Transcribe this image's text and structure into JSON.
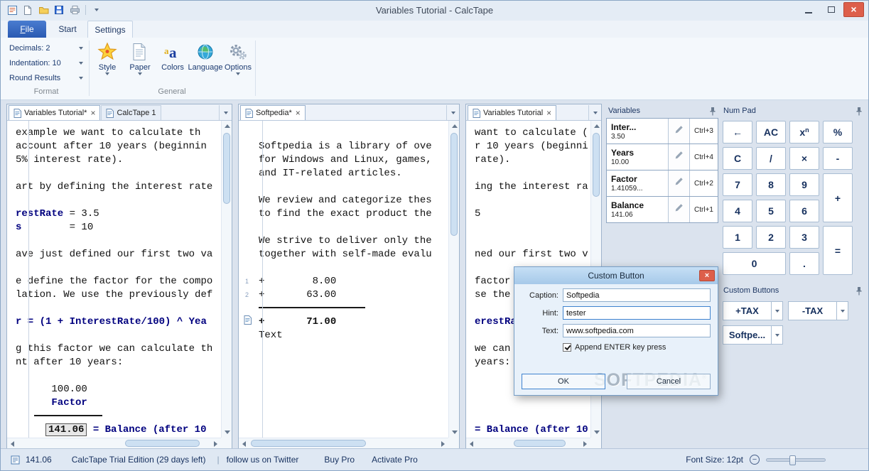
{
  "window": {
    "title": "Variables Tutorial - CalcTape"
  },
  "ribbon": {
    "tabs": [
      {
        "label": "File"
      },
      {
        "label": "Start"
      },
      {
        "label": "Settings"
      }
    ],
    "format_group": {
      "label": "Format",
      "rows": [
        "Decimals: 2",
        "Indentation: 10",
        "Round Results"
      ]
    },
    "general_group": {
      "label": "General",
      "buttons": [
        {
          "label": "Style"
        },
        {
          "label": "Paper"
        },
        {
          "label": "Colors"
        },
        {
          "label": "Language"
        },
        {
          "label": "Options"
        }
      ]
    }
  },
  "panes": [
    {
      "tabs": [
        {
          "label": "Variables Tutorial*",
          "active": true,
          "closable": true
        },
        {
          "label": "CalcTape 1",
          "active": false,
          "closable": false
        }
      ],
      "gutter": false,
      "lines": [
        {
          "s": [
            [
              "example we want to calculate th",
              ""
            ]
          ]
        },
        {
          "s": [
            [
              "account after 10 years (beginnin",
              ""
            ]
          ]
        },
        {
          "s": [
            [
              "5% interest rate).",
              ""
            ]
          ]
        },
        {},
        {
          "s": [
            [
              "art by defining the interest rate",
              ""
            ]
          ]
        },
        {},
        {
          "s": [
            [
              "restRate",
              "nv"
            ],
            [
              " = 3.5",
              ""
            ]
          ]
        },
        {
          "s": [
            [
              "s",
              "nv"
            ],
            [
              "        = 10",
              ""
            ]
          ]
        },
        {},
        {
          "s": [
            [
              "ave just defined our first two va",
              ""
            ]
          ]
        },
        {},
        {
          "s": [
            [
              "e define the factor for the compo",
              ""
            ]
          ]
        },
        {
          "s": [
            [
              "lation. We use the previously def",
              ""
            ]
          ]
        },
        {},
        {
          "s": [
            [
              "r = (1 + InterestRate/100) ^ Yea",
              "nv"
            ]
          ]
        },
        {},
        {
          "s": [
            [
              "g this factor we can calculate th",
              ""
            ]
          ]
        },
        {
          "s": [
            [
              "nt after 10 years:",
              ""
            ]
          ]
        },
        {},
        {
          "s": [
            [
              "      100.00",
              ""
            ]
          ]
        },
        {
          "s": [
            [
              "      Factor",
              "nv"
            ]
          ]
        },
        {
          "hr": true
        },
        {
          "s": [
            [
              "     ",
              ""
            ],
            [
              "141.06",
              "box"
            ],
            [
              " ",
              ""
            ],
            [
              "= Balance (after 10 ",
              "nv"
            ]
          ]
        }
      ]
    },
    {
      "tabs": [
        {
          "label": "Softpedia*",
          "active": true,
          "closable": true
        }
      ],
      "gutter": true,
      "lines": [
        {},
        {
          "s": [
            [
              "Softpedia is a library of ove",
              ""
            ]
          ]
        },
        {
          "s": [
            [
              "for Windows and Linux, games,",
              ""
            ]
          ]
        },
        {
          "s": [
            [
              "and IT-related articles.",
              ""
            ]
          ]
        },
        {},
        {
          "s": [
            [
              "We review and categorize thes",
              ""
            ]
          ]
        },
        {
          "s": [
            [
              "to find the exact product the",
              ""
            ]
          ]
        },
        {},
        {
          "s": [
            [
              "We strive to deliver only the",
              ""
            ]
          ]
        },
        {
          "s": [
            [
              "together with self-made evalu",
              ""
            ]
          ]
        },
        {},
        {
          "n": "1",
          "s": [
            [
              "+        8.00",
              ""
            ]
          ]
        },
        {
          "n": "2",
          "s": [
            [
              "+       63.00",
              ""
            ]
          ]
        },
        {
          "hr": true
        },
        {
          "m": true,
          "s": [
            [
              "+       71.00",
              "b"
            ]
          ]
        },
        {
          "s": [
            [
              "Text",
              ""
            ]
          ]
        }
      ]
    },
    {
      "tabs": [
        {
          "label": "Variables Tutorial",
          "active": true,
          "closable": true
        }
      ],
      "gutter": false,
      "lines": [
        {
          "s": [
            [
              "want to calculate (",
              ""
            ]
          ]
        },
        {
          "s": [
            [
              "r 10 years (beginni",
              ""
            ]
          ]
        },
        {
          "s": [
            [
              "rate).",
              ""
            ]
          ]
        },
        {},
        {
          "s": [
            [
              "ing the interest ra",
              ""
            ]
          ]
        },
        {},
        {
          "s": [
            [
              "5",
              ""
            ]
          ]
        },
        {},
        {},
        {
          "s": [
            [
              "ned our first two v",
              ""
            ]
          ]
        },
        {},
        {
          "s": [
            [
              "factor",
              ""
            ]
          ]
        },
        {
          "s": [
            [
              "se the",
              ""
            ]
          ]
        },
        {},
        {
          "s": [
            [
              "erestRa",
              "nv"
            ]
          ]
        },
        {},
        {
          "s": [
            [
              "we can",
              ""
            ]
          ]
        },
        {
          "s": [
            [
              "years:",
              ""
            ]
          ]
        },
        {},
        {},
        {},
        {},
        {
          "s": [
            [
              "= Balance (after 10",
              "nv"
            ]
          ]
        }
      ]
    }
  ],
  "variables": {
    "title": "Variables",
    "items": [
      {
        "name": "Inter...",
        "value": "3.50",
        "shortcut": "Ctrl+3"
      },
      {
        "name": "Years",
        "value": "10.00",
        "shortcut": "Ctrl+4"
      },
      {
        "name": "Factor",
        "value": "1.41059...",
        "shortcut": "Ctrl+2"
      },
      {
        "name": "Balance",
        "value": "141.06",
        "shortcut": "Ctrl+1"
      }
    ]
  },
  "numpad": {
    "title": "Num Pad",
    "keys": [
      {
        "k": "←"
      },
      {
        "k": "AC"
      },
      {
        "k": "x",
        "sup": "n"
      },
      {
        "k": "%"
      },
      {
        "k": "C"
      },
      {
        "k": "/"
      },
      {
        "k": "×"
      },
      {
        "k": "-"
      },
      {
        "k": "7"
      },
      {
        "k": "8"
      },
      {
        "k": "9"
      },
      {
        "k": "+"
      },
      {
        "k": "4"
      },
      {
        "k": "5"
      },
      {
        "k": "6"
      },
      {
        "k": "1"
      },
      {
        "k": "2"
      },
      {
        "k": "3"
      },
      {
        "k": "="
      },
      {
        "k": "0"
      },
      {
        "k": "."
      }
    ]
  },
  "custom_buttons": {
    "title": "Custom Buttons",
    "buttons": [
      "+TAX",
      "-TAX",
      "Softpe..."
    ]
  },
  "dialog": {
    "title": "Custom Button",
    "fields": [
      {
        "label": "Caption:",
        "value": "Softpedia",
        "focused": false
      },
      {
        "label": "Hint:",
        "value": "tester",
        "focused": true
      },
      {
        "label": "Text:",
        "value": "www.softpedia.com",
        "focused": false
      }
    ],
    "checkbox": {
      "label": "Append ENTER key press",
      "checked": true
    },
    "buttons": {
      "ok": "OK",
      "cancel": "Cancel"
    },
    "watermark": "SOFTPEDIA",
    "watermark_reg": "®"
  },
  "statusbar": {
    "result": "141.06",
    "trial": "CalcTape Trial Edition (29 days left)",
    "separator": "|",
    "twitter": "follow us on Twitter",
    "buy_pro": "Buy Pro",
    "activate_pro": "Activate Pro",
    "font_size": "Font Size: 12pt"
  }
}
